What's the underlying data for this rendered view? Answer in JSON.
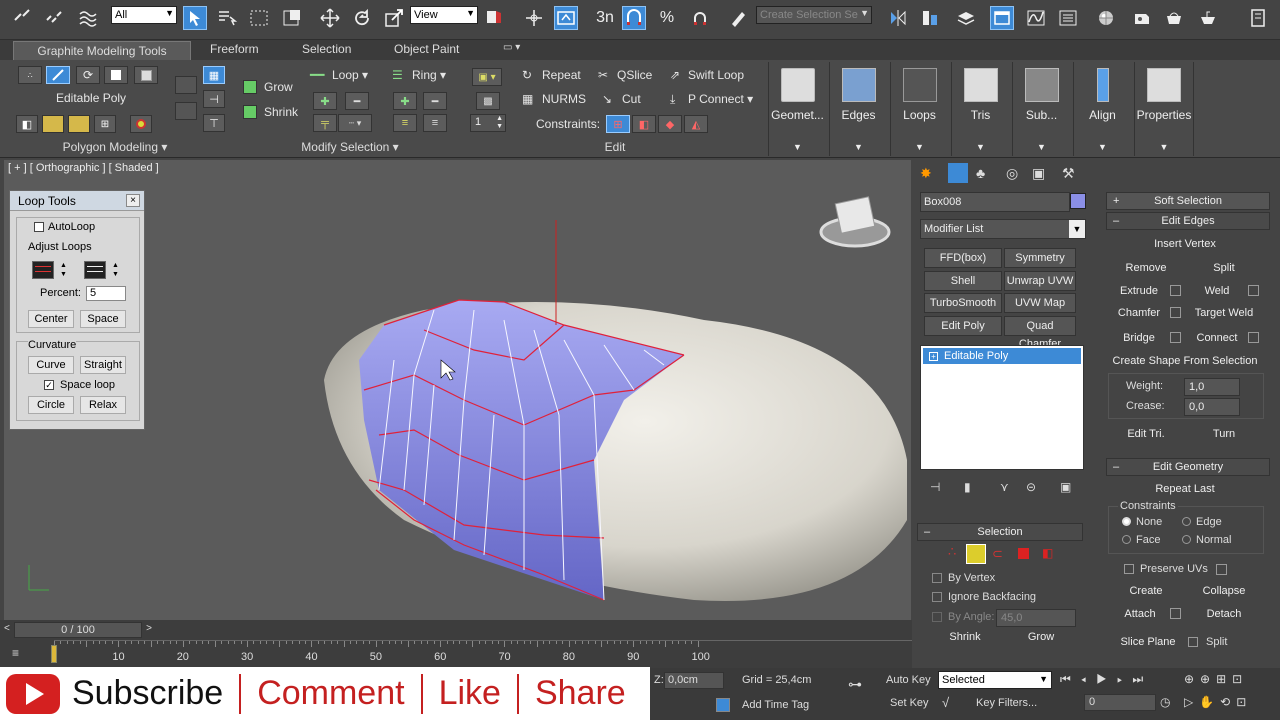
{
  "toolbar": {
    "filter": "All",
    "view": "View",
    "snap_label": "3n",
    "selection_set": "Create Selection Se"
  },
  "ribbon": {
    "tabs": [
      "Graphite Modeling Tools",
      "Freeform",
      "Selection",
      "Object Paint"
    ],
    "polygon_modeling": {
      "object_label": "Editable Poly",
      "group_label": "Polygon Modeling"
    },
    "modify_selection": {
      "grow": "Grow",
      "shrink": "Shrink",
      "loop": "Loop",
      "ring": "Ring",
      "group_label": "Modify Selection"
    },
    "edit": {
      "repeat": "Repeat",
      "qslice": "QSlice",
      "swift_loop": "Swift Loop",
      "nurms": "NURMS",
      "cut": "Cut",
      "p_connect": "P Connect",
      "constraints": "Constraints:",
      "spinner": "1",
      "group_label": "Edit"
    },
    "big_buttons": [
      "Geomet...",
      "Edges",
      "Loops",
      "Tris",
      "Sub...",
      "Align",
      "Properties"
    ]
  },
  "viewport": {
    "label": "[ + ] [ Orthographic ] [ Shaded ]"
  },
  "loop_tools": {
    "title": "Loop Tools",
    "autoloop": "AutoLoop",
    "adjust_loops": "Adjust Loops",
    "percent_label": "Percent:",
    "percent_value": "5",
    "center": "Center",
    "space": "Space",
    "curvature": "Curvature",
    "curve": "Curve",
    "straight": "Straight",
    "space_loop": "Space loop",
    "circle": "Circle",
    "relax": "Relax"
  },
  "modify_panel": {
    "object_name": "Box008",
    "object_color": "#8b8fe6",
    "modifier_list": "Modifier List",
    "modifier_buttons": [
      "FFD(box)",
      "Symmetry",
      "Shell",
      "Unwrap UVW",
      "TurboSmooth",
      "UVW Map",
      "Edit Poly",
      "Quad Chamfer"
    ],
    "stack_item": "Editable Poly",
    "selection": {
      "title": "Selection",
      "by_vertex": "By Vertex",
      "ignore_backfacing": "Ignore Backfacing",
      "by_angle": "By Angle:",
      "angle_value": "45,0",
      "shrink": "Shrink",
      "grow": "Grow"
    }
  },
  "edit_panel": {
    "soft_selection": "Soft Selection",
    "edit_edges": "Edit Edges",
    "insert_vertex": "Insert Vertex",
    "remove": "Remove",
    "split": "Split",
    "extrude": "Extrude",
    "weld": "Weld",
    "chamfer": "Chamfer",
    "target_weld": "Target Weld",
    "bridge": "Bridge",
    "connect": "Connect",
    "create_shape": "Create Shape From Selection",
    "weight_label": "Weight:",
    "weight_value": "1,0",
    "crease_label": "Crease:",
    "crease_value": "0,0",
    "edit_tri": "Edit Tri.",
    "turn": "Turn",
    "edit_geometry": "Edit Geometry",
    "repeat_last": "Repeat Last",
    "constraints": "Constraints",
    "none": "None",
    "edge": "Edge",
    "face": "Face",
    "normal": "Normal",
    "preserve_uvs": "Preserve UVs",
    "create": "Create",
    "collapse": "Collapse",
    "attach": "Attach",
    "detach": "Detach",
    "slice_plane": "Slice Plane",
    "split2": "Split"
  },
  "timeline": {
    "frame_counter": "0 / 100",
    "ticks": [
      "10",
      "20",
      "30",
      "40",
      "50",
      "60",
      "70",
      "80",
      "90",
      "100"
    ]
  },
  "status": {
    "z_value": "0,0cm",
    "grid": "Grid = 25,4cm",
    "add_time_tag": "Add Time Tag",
    "auto_key": "Auto Key",
    "set_key": "Set Key",
    "selected": "Selected",
    "key_filters": "Key Filters...",
    "frame": "0"
  },
  "overlay": {
    "subscribe": "Subscribe",
    "comment": "Comment",
    "like": "Like",
    "share": "Share"
  }
}
